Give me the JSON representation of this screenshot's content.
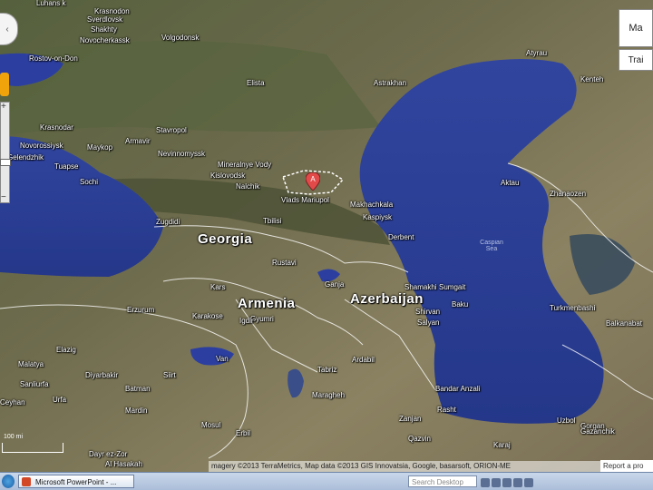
{
  "map": {
    "countries": [
      {
        "id": "georgia",
        "name": "Georgia"
      },
      {
        "id": "armenia",
        "name": "Armenia"
      },
      {
        "id": "azerbaijan",
        "name": "Azerbaijan"
      }
    ],
    "seas": [
      {
        "id": "caspian",
        "name": "Caspian Sea"
      }
    ],
    "cities": [
      "Luhans k",
      "Krasnodon",
      "Sverdlovsk",
      "Shakhty",
      "Novocherkassk",
      "Volgodonsk",
      "Rostov-on-Don",
      "Elista",
      "Astrakhan",
      "Stavropol",
      "Armavir",
      "Krasnodar",
      "Novorossiysk",
      "Maykop",
      "Nevinnomyssk",
      "Mineralnye Vody",
      "Gelendzhik",
      "Tuapse",
      "Sochi",
      "Kislovodsk",
      "Nalchik",
      "Vlads Mariupol",
      "Makhachkala",
      "Kaspiysk",
      "Derbent",
      "Zugdidi",
      "Tbilisi",
      "Rustavi",
      "Shamakhi",
      "Sumgait",
      "Baku",
      "Shirvan",
      "Salyan",
      "Kars",
      "Ganja",
      "Gyumri",
      "Erzurum",
      "Karakose",
      "Igdir",
      "Elazig",
      "Malatya",
      "Van",
      "Diyarbakir",
      "Batman",
      "Siirt",
      "Urfa",
      "Mardin",
      "Mosul",
      "Erbil",
      "Tabriz",
      "Maragheh",
      "Ardabil",
      "Rasht",
      "Qazvin",
      "Zanjan",
      "Karaj",
      "Gorgan",
      "Bandar Anzali",
      "Aktau",
      "Zhanaozen",
      "Kenteh",
      "Atyrau",
      "Turkmenbashi",
      "Balkanabat",
      "Uzbol",
      "Gazanchik",
      "Ceyhan",
      "Dayr ez-Zor",
      "Al Hasakah",
      "Sanliurfa"
    ],
    "marker": {
      "label": "A"
    }
  },
  "controls": {
    "pan_arrow": "‹",
    "zoom_in": "+",
    "zoom_out": "−",
    "map_type": "Ma",
    "map_type2": "Trai",
    "scale": "100 mi"
  },
  "attribution": "magery ©2013 TerraMetrics, Map data ©2013 GIS Innovatsia, Google, basarsoft, ORION-ME",
  "report": "Report a pro",
  "taskbar": {
    "app_label": "Microsoft PowerPoint - ...",
    "search_placeholder": "Search Desktop"
  },
  "colors": {
    "sea": "#2c3fa0",
    "land_dark": "#3f4a2c",
    "land_light": "#8a8465",
    "border": "#ffffff",
    "marker": "#e24a4a"
  }
}
